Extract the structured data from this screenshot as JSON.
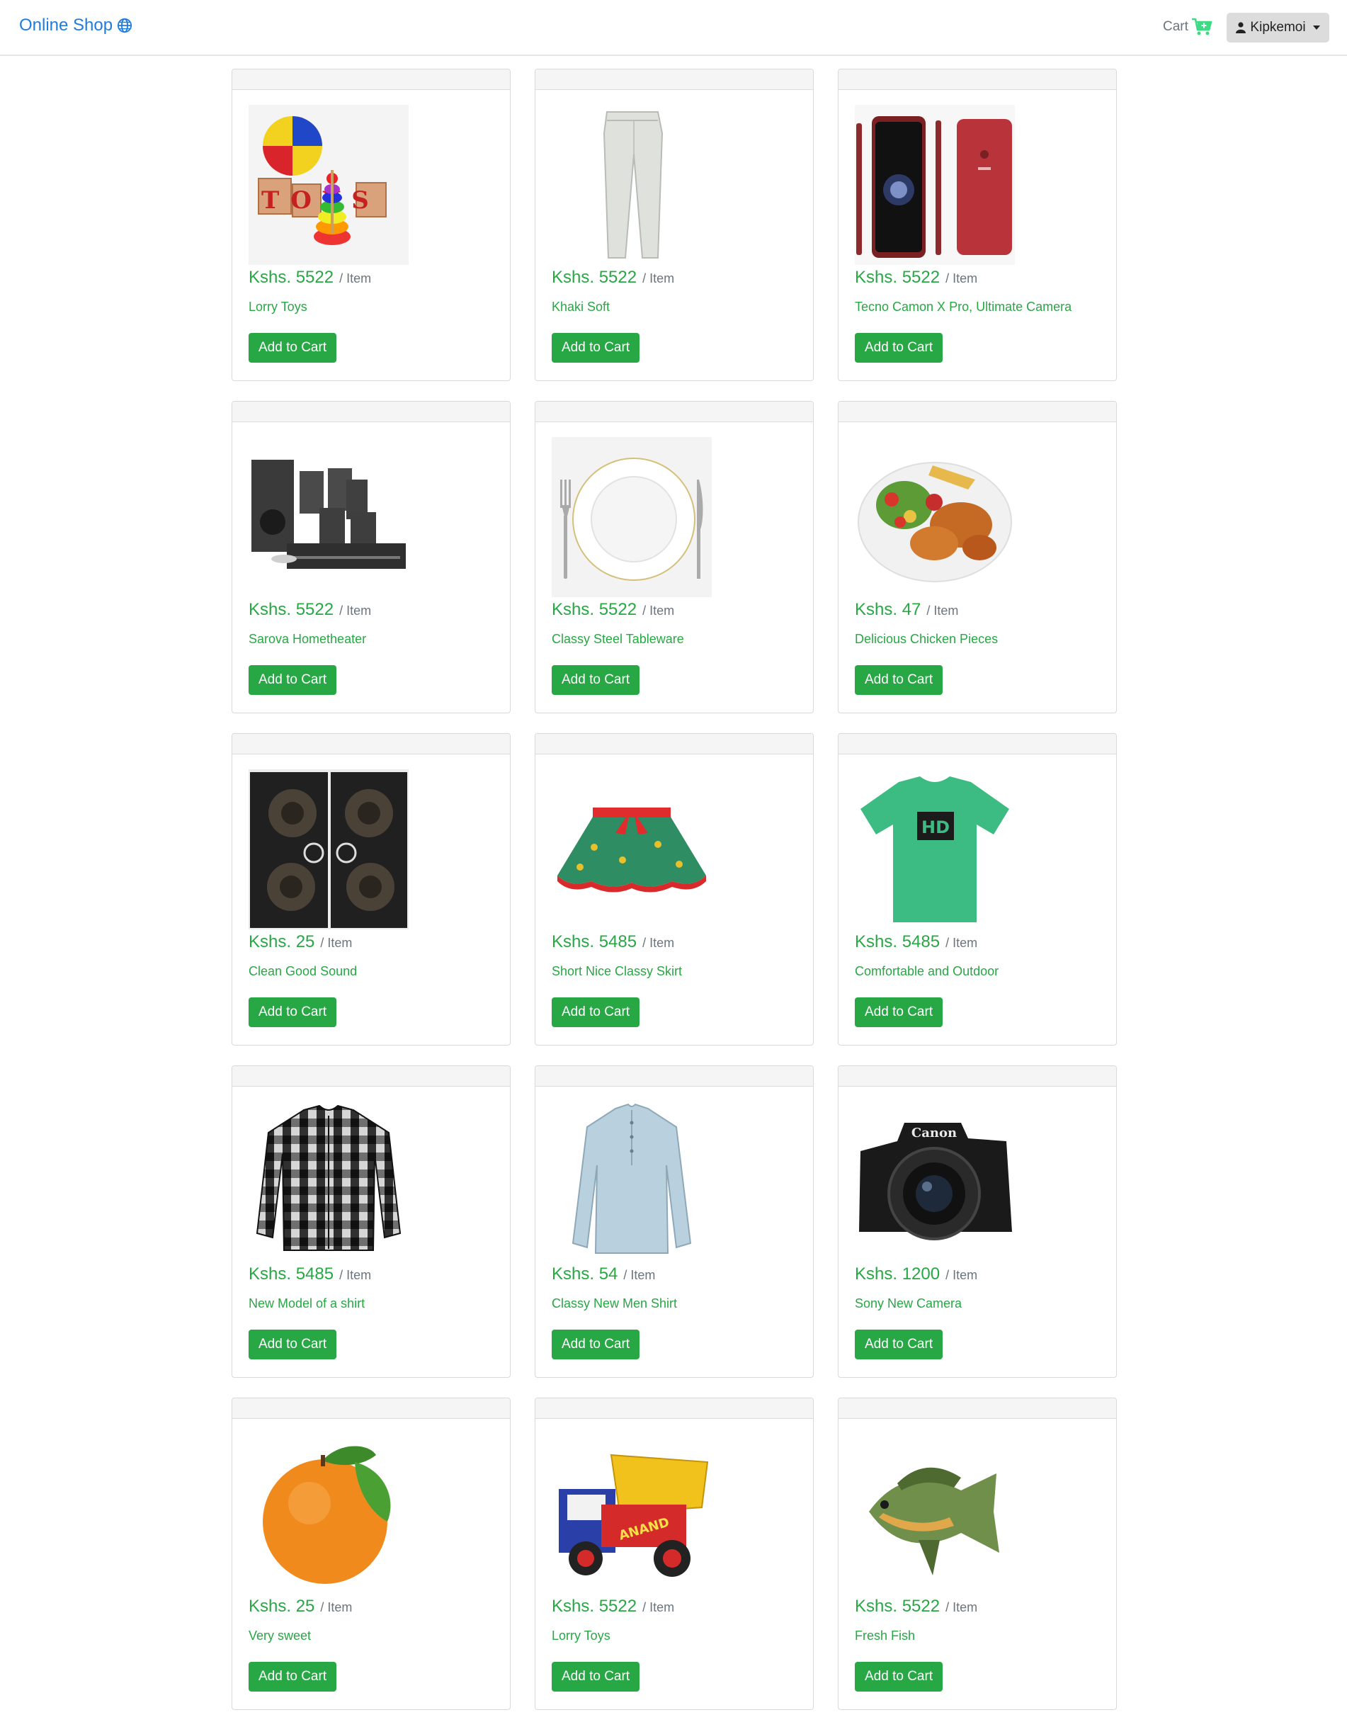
{
  "navbar": {
    "brand": "Online Shop",
    "brand_icon": "globe-icon",
    "cart_label": "Cart",
    "cart_icon": "cart-plus-icon",
    "user_name": "Kipkemoi",
    "user_icon": "person-icon",
    "accent": "#1f7ce0",
    "cart_icon_color": "#3ddc84"
  },
  "products": [
    {
      "price": "Kshs. 5522",
      "unit": "/ Item",
      "name": "Lorry Toys",
      "button": "Add to Cart",
      "image": "toys-image"
    },
    {
      "price": "Kshs. 5522",
      "unit": "/ Item",
      "name": "Khaki Soft",
      "button": "Add to Cart",
      "image": "trousers-image"
    },
    {
      "price": "Kshs. 5522",
      "unit": "/ Item",
      "name": "Tecno Camon X Pro, Ultimate Camera",
      "button": "Add to Cart",
      "image": "smartphone-image"
    },
    {
      "price": "Kshs. 5522",
      "unit": "/ Item",
      "name": "Sarova Hometheater",
      "button": "Add to Cart",
      "image": "home-theater-image"
    },
    {
      "price": "Kshs. 5522",
      "unit": "/ Item",
      "name": "Classy Steel Tableware",
      "button": "Add to Cart",
      "image": "tableware-image"
    },
    {
      "price": "Kshs. 47",
      "unit": "/ Item",
      "name": "Delicious Chicken Pieces",
      "button": "Add to Cart",
      "image": "chicken-plate-image"
    },
    {
      "price": "Kshs. 25",
      "unit": "/ Item",
      "name": "Clean Good Sound",
      "button": "Add to Cart",
      "image": "speakers-image"
    },
    {
      "price": "Kshs. 5485",
      "unit": "/ Item",
      "name": "Short Nice Classy Skirt",
      "button": "Add to Cart",
      "image": "skirt-image"
    },
    {
      "price": "Kshs. 5485",
      "unit": "/ Item",
      "name": "Comfortable and Outdoor",
      "button": "Add to Cart",
      "image": "tshirt-image"
    },
    {
      "price": "Kshs. 5485",
      "unit": "/ Item",
      "name": "New Model of a shirt",
      "button": "Add to Cart",
      "image": "plaid-shirt-image"
    },
    {
      "price": "Kshs. 54",
      "unit": "/ Item",
      "name": "Classy New Men Shirt",
      "button": "Add to Cart",
      "image": "men-shirt-image"
    },
    {
      "price": "Kshs. 1200",
      "unit": "/ Item",
      "name": "Sony New Camera",
      "button": "Add to Cart",
      "image": "camera-image"
    },
    {
      "price": "Kshs. 25",
      "unit": "/ Item",
      "name": "Very sweet",
      "button": "Add to Cart",
      "image": "orange-image"
    },
    {
      "price": "Kshs. 5522",
      "unit": "/ Item",
      "name": "Lorry Toys",
      "button": "Add to Cart",
      "image": "toy-truck-image"
    },
    {
      "price": "Kshs. 5522",
      "unit": "/ Item",
      "name": "Fresh Fish",
      "button": "Add to Cart",
      "image": "fish-image"
    }
  ],
  "image_text": {
    "toys_letters": "TOYS",
    "camera_brand": "Canon",
    "tshirt_logo": "HD",
    "truck_brand": "ANAND"
  },
  "colors": {
    "price_green": "#28a745",
    "button_green": "#28a745",
    "unit_gray": "#6c757d",
    "card_header": "#f5f5f5"
  }
}
